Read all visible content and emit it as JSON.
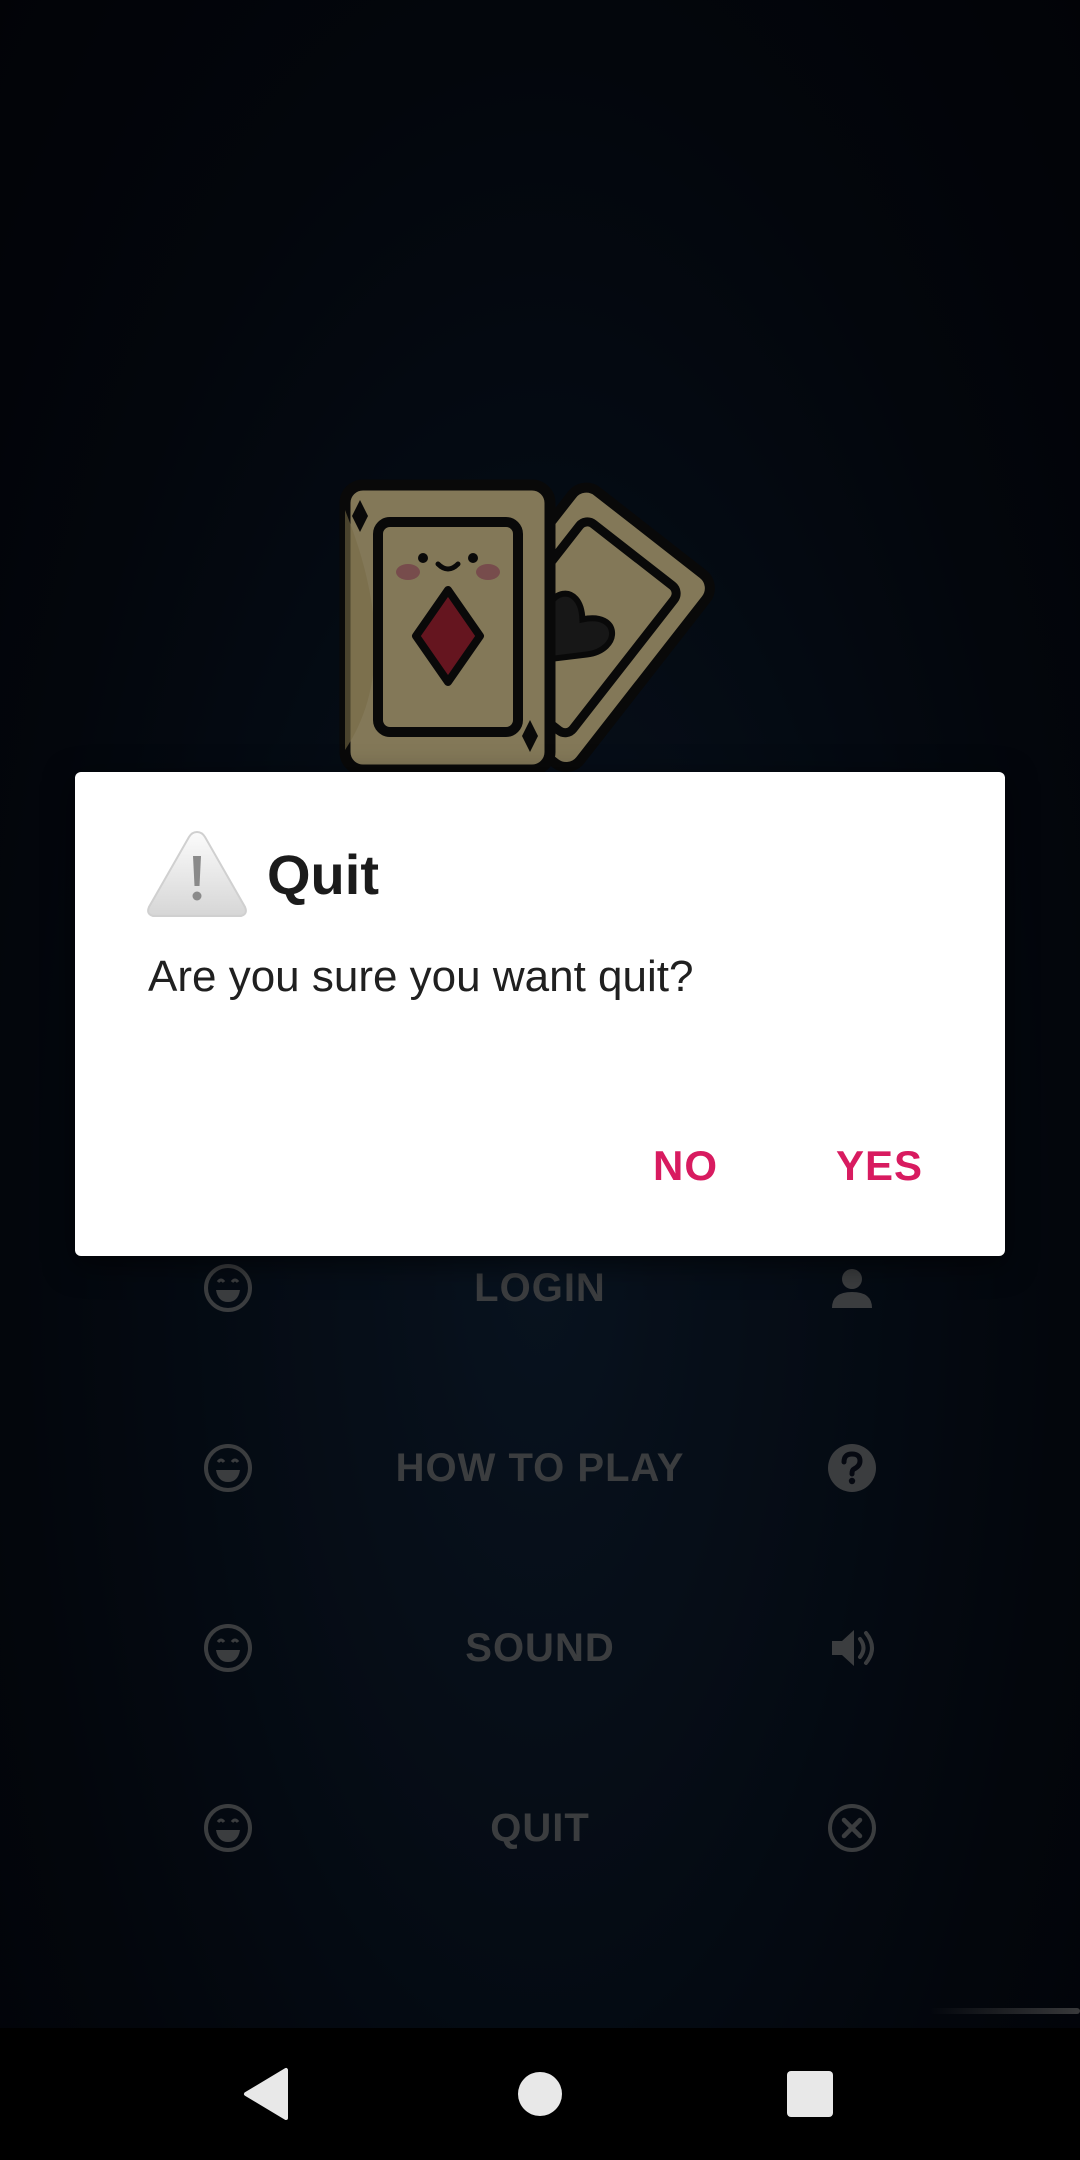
{
  "screen": {
    "background_color": "#060a14"
  },
  "logo": {
    "icon": "playing-cards-icon"
  },
  "menu": {
    "items": [
      {
        "label": "LOGIN",
        "left_icon": "smiley-icon",
        "right_icon": "person-icon"
      },
      {
        "label": "HOW TO PLAY",
        "left_icon": "smiley-icon",
        "right_icon": "help-circle-icon"
      },
      {
        "label": "SOUND",
        "left_icon": "smiley-icon",
        "right_icon": "volume-icon"
      },
      {
        "label": "QUIT",
        "left_icon": "smiley-icon",
        "right_icon": "close-circle-icon"
      }
    ],
    "text_color": "#6c6f74"
  },
  "dialog": {
    "icon": "warning-icon",
    "title": "Quit",
    "message": "Are you sure you want quit?",
    "buttons": {
      "no": "NO",
      "yes": "YES"
    },
    "accent_color": "#d81b60"
  },
  "navbar": {
    "buttons": [
      "back-icon",
      "home-icon",
      "recents-icon"
    ]
  }
}
